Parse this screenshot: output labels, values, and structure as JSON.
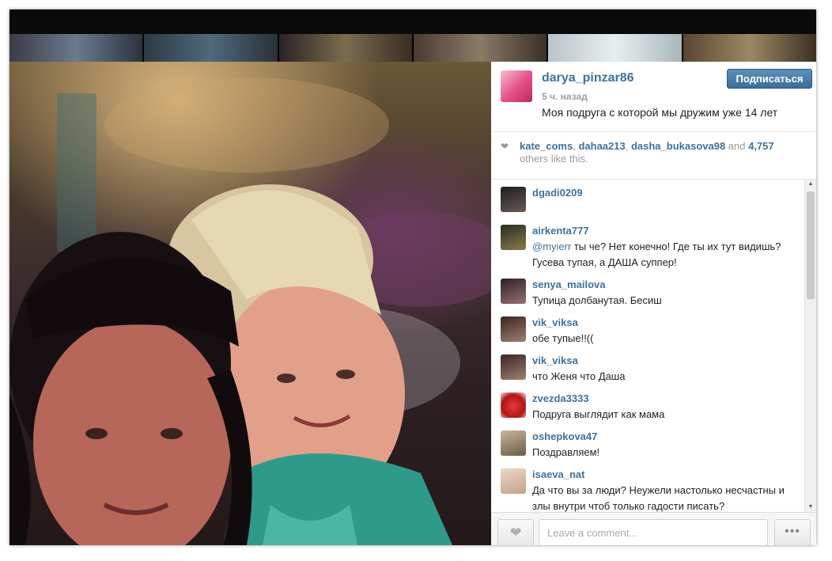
{
  "post": {
    "username": "darya_pinzar86",
    "follow_label": "Подписаться",
    "time_ago": "5 ч. назад",
    "caption": "Моя подруга с которой мы дружим уже 14 лет"
  },
  "likes": {
    "icon": "heart-icon",
    "users": [
      "kate_coms",
      "dahaa213",
      "dasha_bukasova98"
    ],
    "sep1": ", ",
    "sep2": ", ",
    "and_text": " and ",
    "count": "4,757",
    "others_text": " others like this."
  },
  "comments": [
    {
      "user": "dgadi0209",
      "text": ""
    },
    {
      "user": "airkenta777",
      "mention": "@myierr",
      "text": " ты че? Нет конечно! Где ты их тут видишь? Гусева тупая, а ДАША суппер!"
    },
    {
      "user": "senya_mailova",
      "text": "Тупица долбанутая. Бесиш"
    },
    {
      "user": "vik_viksa",
      "text": "обе тупые!!(("
    },
    {
      "user": "vik_viksa",
      "text": "что Женя что Даша"
    },
    {
      "user": "zvezda3333",
      "text": "Подруга выглядит как мама "
    },
    {
      "user": "oshepkova47",
      "text": "Поздравляем!"
    },
    {
      "user": "isaeva_nat",
      "text": "Да что вы за люди? Неужели настолько несчастны и злы внутри чтоб только гадости писать?"
    }
  ],
  "footer": {
    "comment_placeholder": "Leave a comment...",
    "like_icon": "heart-icon",
    "more_icon": "ellipsis-icon",
    "more_label": "•••"
  },
  "colors": {
    "link_blue": "#3f729b",
    "follow_button": "#3b6d9a"
  }
}
